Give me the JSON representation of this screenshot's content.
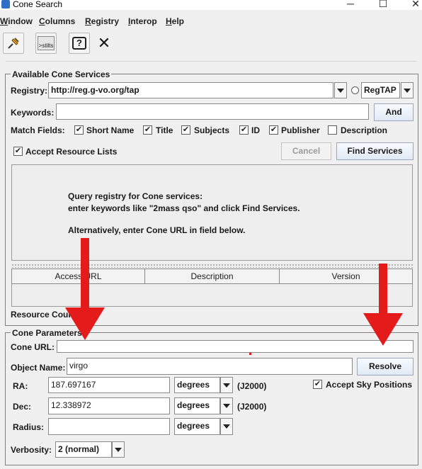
{
  "window": {
    "title": "Cone Search",
    "controls": {
      "minimize": "─",
      "maximize": "☐",
      "close": "✕"
    }
  },
  "menu": [
    {
      "label": "Window",
      "mnemonic": "W"
    },
    {
      "label": "Columns",
      "mnemonic": "C"
    },
    {
      "label": "Registry",
      "mnemonic": "R"
    },
    {
      "label": "Interop",
      "mnemonic": "I"
    },
    {
      "label": "Help",
      "mnemonic": "H"
    }
  ],
  "toolbar": {
    "stilts_label": ">stilts",
    "help_glyph": "?",
    "close_glyph": "✕"
  },
  "services": {
    "group_title": "Available Cone Services",
    "registry_label": "Registry:",
    "registry_value": "http://reg.g-vo.org/tap",
    "protocol_value": "RegTAP",
    "keywords_label": "Keywords:",
    "keywords_value": "",
    "and_button": "And",
    "match_fields_label": "Match Fields:",
    "match_fields": [
      {
        "label": "Short Name",
        "checked": true
      },
      {
        "label": "Title",
        "checked": true
      },
      {
        "label": "Subjects",
        "checked": true
      },
      {
        "label": "ID",
        "checked": true
      },
      {
        "label": "Publisher",
        "checked": true
      },
      {
        "label": "Description",
        "checked": false
      }
    ],
    "accept_resource_lists": "Accept Resource Lists",
    "accept_resource_lists_checked": true,
    "cancel_button": "Cancel",
    "find_button": "Find Services",
    "message": [
      "Query registry for Cone services:",
      "enter keywords like \"2mass qso\" and click Find Services.",
      "Alternatively, enter Cone URL in field below."
    ],
    "columns": [
      "Access URL",
      "Description",
      "Version"
    ],
    "resource_count_label": "Resource Count:"
  },
  "cone": {
    "group_title": "Cone Parameters",
    "cone_url_label": "Cone URL:",
    "cone_url_value": "",
    "object_name_label": "Object Name:",
    "object_name_value": "virgo",
    "resolve_button": "Resolve",
    "accept_sky_positions": "Accept Sky Positions",
    "accept_sky_positions_checked": true,
    "ra_label": "RA:",
    "ra_value": "187.697167",
    "ra_unit": "degrees",
    "ra_system": "(J2000)",
    "dec_label": "Dec:",
    "dec_value": "12.338972",
    "dec_unit": "degrees",
    "dec_system": "(J2000)",
    "radius_label": "Radius:",
    "radius_value": "",
    "radius_unit": "degrees",
    "verbosity_label": "Verbosity:",
    "verbosity_value": "2 (normal)"
  },
  "colors": {
    "annotation_arrow": "#e51a1a",
    "button_border": "#9aa7bd"
  }
}
